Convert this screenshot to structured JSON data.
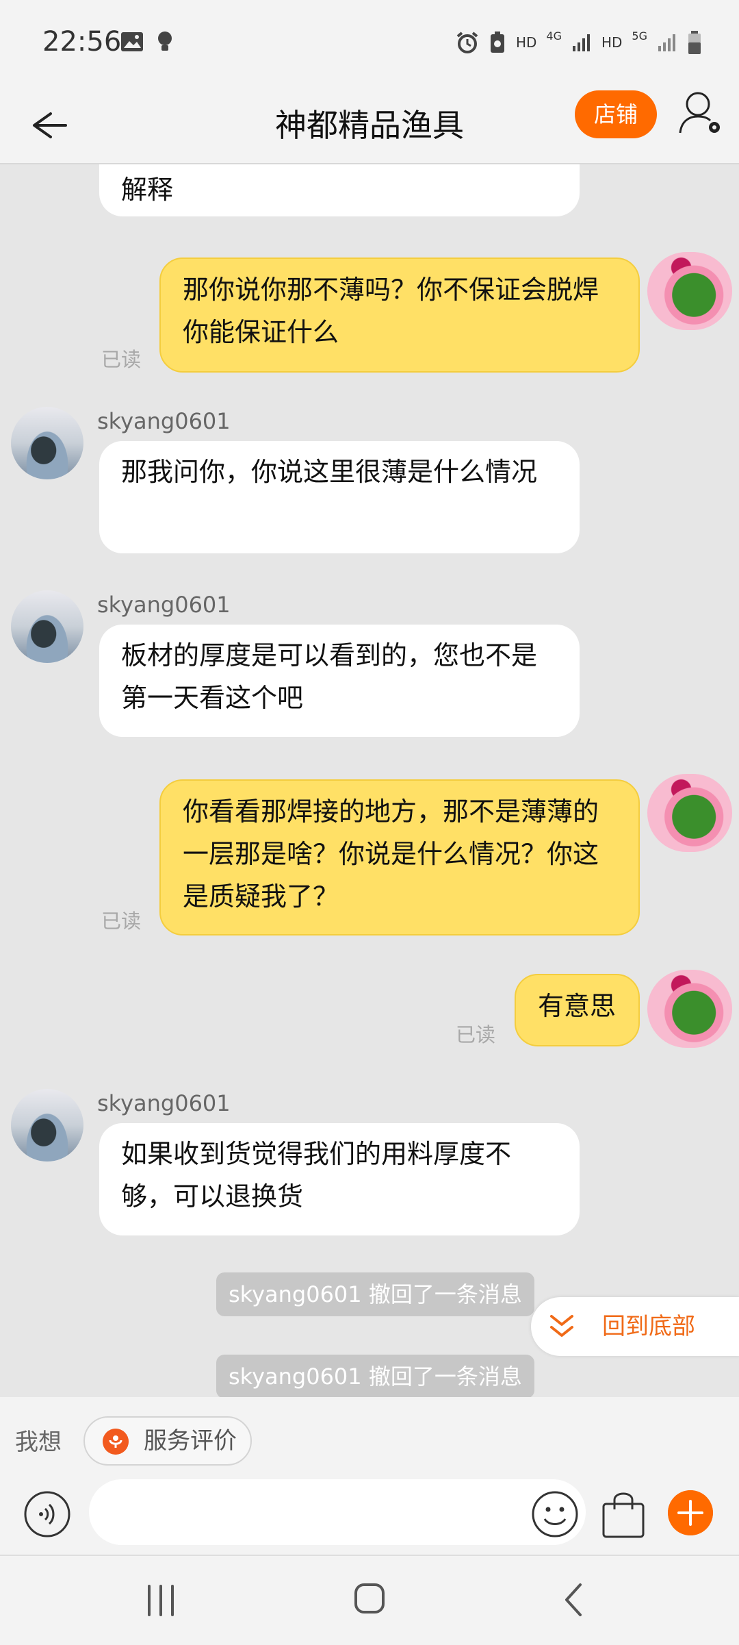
{
  "status_bar": {
    "time": "22:56",
    "left_icons": [
      "image-icon",
      "bulb-icon"
    ],
    "right_icons": [
      "alarm-icon",
      "battery-saver-icon",
      "hd-4g-signal-icon",
      "hd-5g-signal-icon",
      "battery-icon"
    ],
    "right_text": [
      "HD",
      "4G",
      "HD",
      "5G"
    ]
  },
  "header": {
    "title": "神都精品渔具",
    "store_button": "店铺"
  },
  "messages": [
    {
      "id": 1,
      "from": "other",
      "text": "解释"
    },
    {
      "id": 2,
      "from": "self",
      "text": "那你说你那不薄吗？你不保证会脱焊你能保证什么",
      "status": "已读"
    },
    {
      "id": 3,
      "from": "other",
      "sender": "skyang0601",
      "text": "那我问你，你说这里很薄是什么情况"
    },
    {
      "id": 4,
      "from": "other",
      "sender": "skyang0601",
      "text": "板材的厚度是可以看到的，您也不是第一天看这个吧"
    },
    {
      "id": 5,
      "from": "self",
      "text": "你看看那焊接的地方，那不是薄薄的一层那是啥？你说是什么情况？你这是质疑我了？",
      "status": "已读"
    },
    {
      "id": 6,
      "from": "self",
      "text": "有意思",
      "status": "已读"
    },
    {
      "id": 7,
      "from": "other",
      "sender": "skyang0601",
      "text": "如果收到货觉得我们的用料厚度不够，可以退换货"
    }
  ],
  "system_messages": [
    "skyang0601 撤回了一条消息",
    "skyang0601 撤回了一条消息"
  ],
  "jump_to_bottom": "回到底部",
  "quick_bar": {
    "label": "我想",
    "service_chip": "服务评价"
  },
  "input": {
    "placeholder": "",
    "value": ""
  },
  "colors": {
    "accent": "#ff6a00",
    "self_bubble": "#ffe066",
    "other_bubble": "#ffffff",
    "background": "#e6e6e6"
  }
}
